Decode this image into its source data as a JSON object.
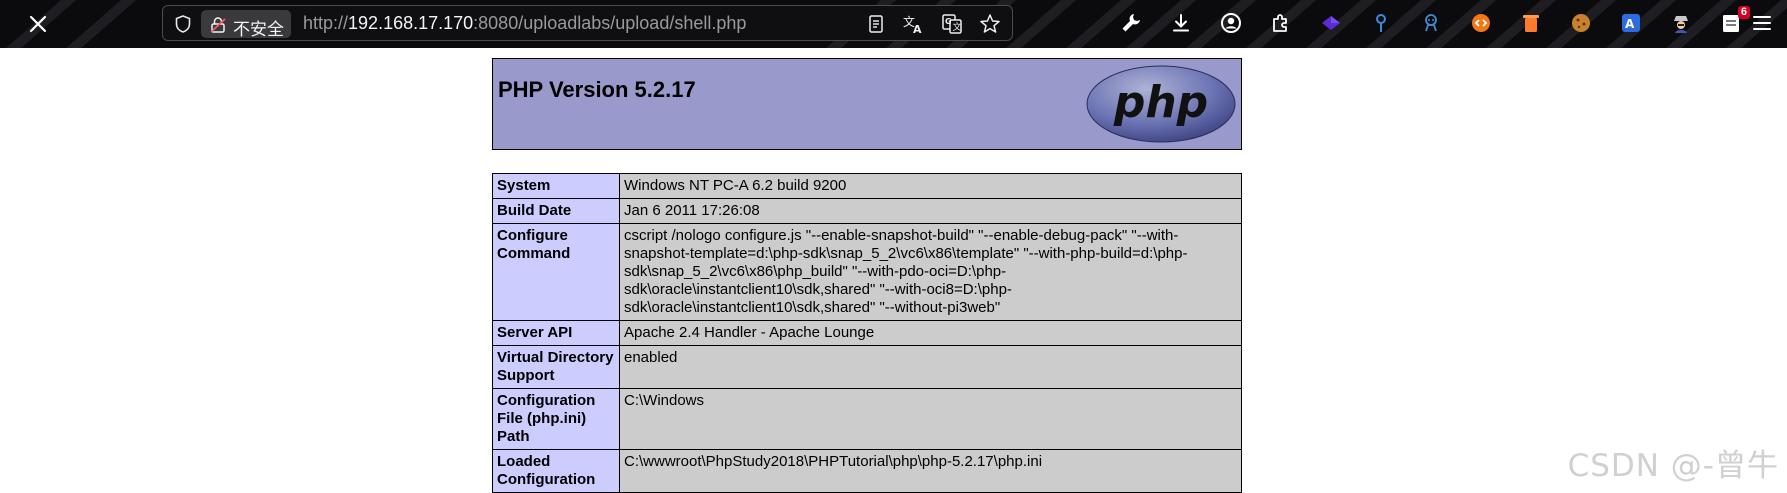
{
  "browser": {
    "security_label": "不安全",
    "url_prefix": "http://",
    "url_host": "192.168.17.170",
    "url_rest": ":8080/uploadlabs/upload/shell.php",
    "url_icons": [
      "reader-mode-icon",
      "translate-icon",
      "page-translate-icon",
      "bookmark-star-icon"
    ],
    "extensions": [
      {
        "name": "wrench-icon",
        "color": "#ffffff"
      },
      {
        "name": "download-icon",
        "color": "#ffffff"
      },
      {
        "name": "account-icon",
        "color": "#ffffff"
      },
      {
        "name": "extensions-icon",
        "color": "#ffffff"
      },
      {
        "name": "purple-diamond-extension-icon",
        "color": "#5b2bd6"
      },
      {
        "name": "pin-extension-icon",
        "color": "#3b8bd8"
      },
      {
        "name": "robot-extension-icon",
        "color": "#3b8bd8"
      },
      {
        "name": "orange-code-extension-icon",
        "color": "#f07818"
      },
      {
        "name": "trash-extension-icon",
        "color": "#ff7a2a"
      },
      {
        "name": "cookie-extension-icon",
        "color": "#c9812c"
      },
      {
        "name": "translate-extension-icon",
        "color": "#2d6be0"
      },
      {
        "name": "spy-extension-icon",
        "color": "#c8c8c8"
      },
      {
        "name": "notes-extension-icon",
        "color": "#ffffff",
        "badge": "6"
      }
    ]
  },
  "phpinfo": {
    "title": "PHP Version 5.2.17",
    "logo_text": "php",
    "rows": [
      {
        "key": "System",
        "value": "Windows NT PC-A 6.2 build 9200"
      },
      {
        "key": "Build Date",
        "value": "Jan 6 2011 17:26:08"
      },
      {
        "key": "Configure\nCommand",
        "value": "cscript /nologo configure.js \"--enable-snapshot-build\" \"--enable-debug-pack\" \"--with-\nsnapshot-template=d:\\php-sdk\\snap_5_2\\vc6\\x86\\template\" \"--with-php-build=d:\\php-\nsdk\\snap_5_2\\vc6\\x86\\php_build\" \"--with-pdo-oci=D:\\php-\nsdk\\oracle\\instantclient10\\sdk,shared\" \"--with-oci8=D:\\php-\nsdk\\oracle\\instantclient10\\sdk,shared\" \"--without-pi3web\""
      },
      {
        "key": "Server API",
        "value": "Apache 2.4 Handler - Apache Lounge"
      },
      {
        "key": "Virtual Directory\nSupport",
        "value": "enabled"
      },
      {
        "key": "Configuration\nFile (php.ini)\nPath",
        "value": "C:\\Windows"
      },
      {
        "key": "Loaded\nConfiguration",
        "value": "C:\\wwwroot\\PhpStudy2018\\PHPTutorial\\php\\php-5.2.17\\php.ini"
      }
    ]
  },
  "watermark": "CSDN @-曾牛",
  "colors": {
    "header_bg": "#9999cc",
    "key_bg": "#ccccff",
    "value_bg": "#cccccc",
    "toolbar_bg": "#0b0b0e"
  }
}
